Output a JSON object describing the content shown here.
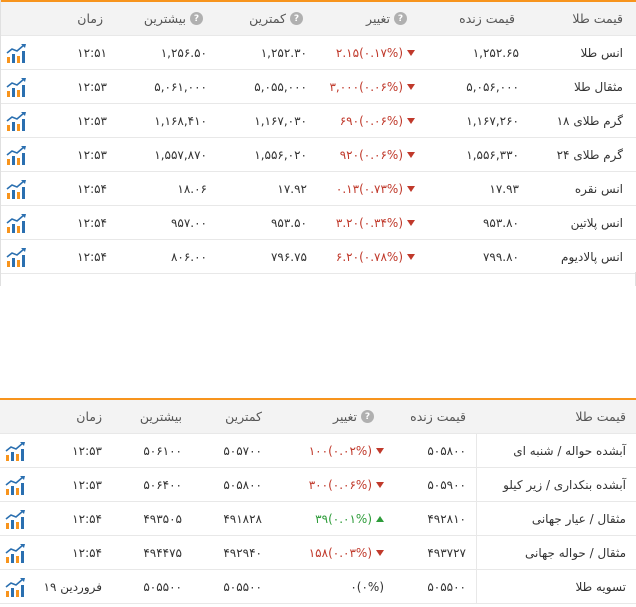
{
  "colors": {
    "accent": "#f7941d",
    "down": "#c0392b",
    "up": "#2e9c3a",
    "header_bg": "#f3f3f3"
  },
  "icon": "trend-chart-icon",
  "table1": {
    "headers": {
      "name": "قیمت طلا",
      "live": "قیمت زنده",
      "change": "تغییر",
      "low": "کمترین",
      "high": "بیشترین",
      "time": "زمان",
      "hint": "?"
    },
    "rows": [
      {
        "name": "انس طلا",
        "live": "۱,۲۵۲.۶۵",
        "pct": "(۰.۱۷%)",
        "val": "۲.۱۵",
        "dir": "down",
        "low": "۱,۲۵۲.۳۰",
        "high": "۱,۲۵۶.۵۰",
        "time": "۱۲:۵۱"
      },
      {
        "name": "مثقال طلا",
        "live": "۵,۰۵۶,۰۰۰",
        "pct": "(۰.۰۶%)",
        "val": "۳,۰۰۰",
        "dir": "down",
        "low": "۵,۰۵۵,۰۰۰",
        "high": "۵,۰۶۱,۰۰۰",
        "time": "۱۲:۵۳"
      },
      {
        "name": "گرم طلای ۱۸",
        "live": "۱,۱۶۷,۲۶۰",
        "pct": "(۰.۰۶%)",
        "val": "۶۹۰",
        "dir": "down",
        "low": "۱,۱۶۷,۰۳۰",
        "high": "۱,۱۶۸,۴۱۰",
        "time": "۱۲:۵۳"
      },
      {
        "name": "گرم طلای ۲۴",
        "live": "۱,۵۵۶,۳۳۰",
        "pct": "(۰.۰۶%)",
        "val": "۹۲۰",
        "dir": "down",
        "low": "۱,۵۵۶,۰۲۰",
        "high": "۱,۵۵۷,۸۷۰",
        "time": "۱۲:۵۳"
      },
      {
        "name": "انس نقره",
        "live": "۱۷.۹۳",
        "pct": "(۰.۷۳%)",
        "val": "۰.۱۳",
        "dir": "down",
        "low": "۱۷.۹۲",
        "high": "۱۸.۰۶",
        "time": "۱۲:۵۴"
      },
      {
        "name": "انس پلاتین",
        "live": "۹۵۳.۸۰",
        "pct": "(۰.۳۴%)",
        "val": "۳.۲۰",
        "dir": "down",
        "low": "۹۵۳.۵۰",
        "high": "۹۵۷.۰۰",
        "time": "۱۲:۵۴"
      },
      {
        "name": "انس پالادیوم",
        "live": "۷۹۹.۸۰",
        "pct": "(۰.۷۸%)",
        "val": "۶.۲۰",
        "dir": "down",
        "low": "۷۹۶.۷۵",
        "high": "۸۰۶.۰۰",
        "time": "۱۲:۵۴"
      }
    ]
  },
  "table2": {
    "headers": {
      "name": "قیمت طلا",
      "live": "قیمت زنده",
      "change": "تغییر",
      "low": "کمترین",
      "high": "بیشترین",
      "time": "زمان",
      "hint": "?"
    },
    "rows": [
      {
        "name": "آبشده حواله / شنبه ای",
        "live": "۵۰۵۸۰۰",
        "pct": "(۰.۰۲%)",
        "val": "۱۰۰",
        "dir": "down",
        "low": "۵۰۵۷۰۰",
        "high": "۵۰۶۱۰۰",
        "time": "۱۲:۵۳"
      },
      {
        "name": "آبشده بنکداری / زیر کیلو",
        "live": "۵۰۵۹۰۰",
        "pct": "(۰.۰۶%)",
        "val": "۳۰۰",
        "dir": "down",
        "low": "۵۰۵۸۰۰",
        "high": "۵۰۶۴۰۰",
        "time": "۱۲:۵۳"
      },
      {
        "name": "مثقال / عیار جهانی",
        "live": "۴۹۲۸۱۰",
        "pct": "(۰.۰۱%)",
        "val": "۳۹",
        "dir": "up",
        "low": "۴۹۱۸۲۸",
        "high": "۴۹۳۵۰۵",
        "time": "۱۲:۵۴"
      },
      {
        "name": "مثقال / حواله جهانی",
        "live": "۴۹۳۷۲۷",
        "pct": "(۰.۰۳%)",
        "val": "۱۵۸",
        "dir": "down",
        "low": "۴۹۲۹۴۰",
        "high": "۴۹۴۴۷۵",
        "time": "۱۲:۵۴"
      },
      {
        "name": "تسویه طلا",
        "live": "۵۰۵۵۰۰",
        "pct": "(۰%)",
        "val": "۰",
        "dir": "flat",
        "low": "۵۰۵۵۰۰",
        "high": "۵۰۵۵۰۰",
        "time": "۱۹ فروردین"
      }
    ]
  }
}
